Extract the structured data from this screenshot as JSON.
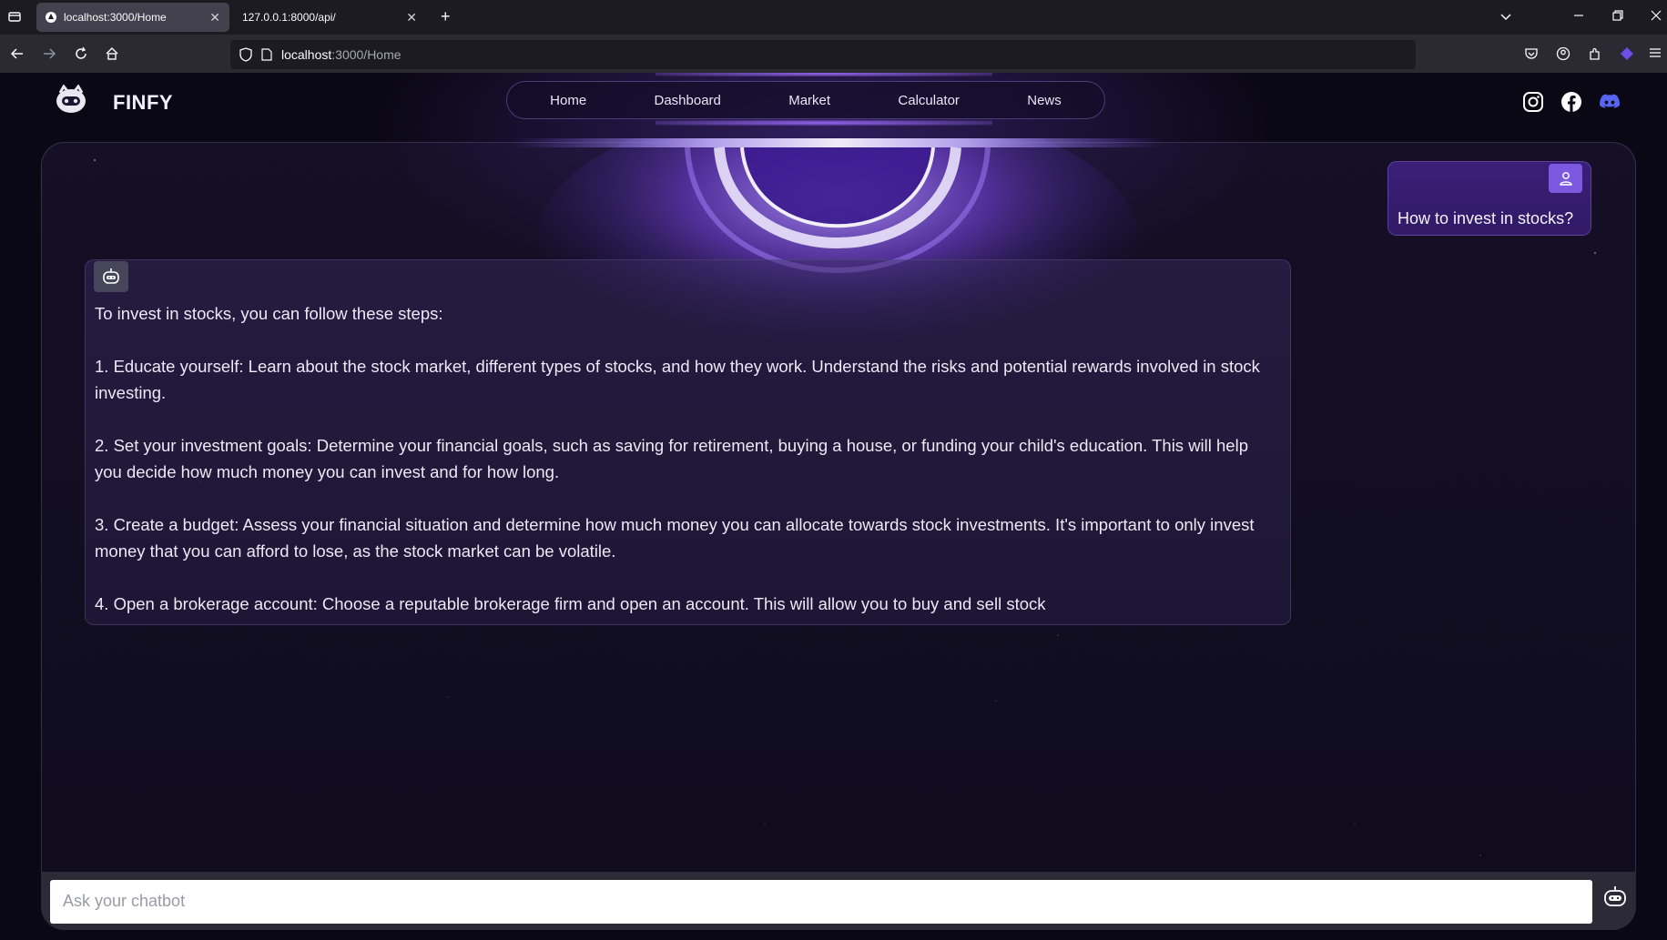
{
  "browser": {
    "tabs": [
      {
        "title": "localhost:3000/Home",
        "active": true
      },
      {
        "title": "127.0.0.1:8000/api/",
        "active": false
      }
    ],
    "url_host": "localhost",
    "url_path": ":3000/Home",
    "new_tab": "+"
  },
  "nav": {
    "brand": "FINFY",
    "links": [
      "Home",
      "Dashboard",
      "Market",
      "Calculator",
      "News"
    ],
    "social": [
      "instagram-icon",
      "facebook-icon",
      "discord-icon"
    ]
  },
  "chat": {
    "user_message": "How to invest in stocks?",
    "bot_paragraphs": [
      "To invest in stocks, you can follow these steps:",
      "1. Educate yourself: Learn about the stock market, different types of stocks, and how they work. Understand the risks and potential rewards involved in stock investing.",
      "2. Set your investment goals: Determine your financial goals, such as saving for retirement, buying a house, or funding your child's education. This will help you decide how much money you can invest and for how long.",
      "3. Create a budget: Assess your financial situation and determine how much money you can allocate towards stock investments. It's important to only invest money that you can afford to lose, as the stock market can be volatile.",
      "4. Open a brokerage account: Choose a reputable brokerage firm and open an account. This will allow you to buy and sell stock"
    ],
    "input_placeholder": "Ask your chatbot"
  },
  "colors": {
    "accent": "#7b58e0",
    "background": "#0b0816",
    "user_bubble": "#3a1f78"
  }
}
